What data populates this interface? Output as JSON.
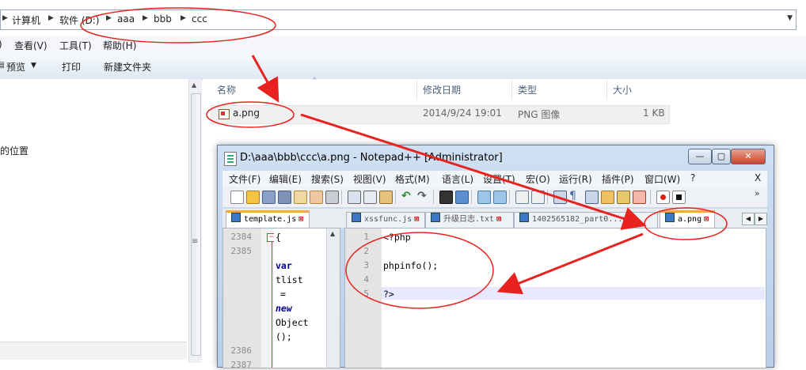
{
  "explorer": {
    "breadcrumbs": [
      "计算机",
      "软件 (D:)",
      "aaa",
      "bbb",
      "ccc"
    ],
    "menu": [
      "查看(V)",
      "工具(T)",
      "帮助(H)"
    ],
    "toolbar": [
      "预览",
      "打印",
      "新建文件夹"
    ],
    "nav_text": "的位置",
    "columns": [
      "名称",
      "修改日期",
      "类型",
      "大小"
    ],
    "file": {
      "name": "a.png",
      "date": "2014/9/24 19:01",
      "type": "PNG 图像",
      "size": "1 KB"
    }
  },
  "npp": {
    "title": "D:\\aaa\\bbb\\ccc\\a.png - Notepad++ [Administrator]",
    "buttons": {
      "min": "—",
      "max": "▢",
      "close": "✕"
    },
    "menu": [
      "文件(F)",
      "编辑(E)",
      "搜索(S)",
      "视图(V)",
      "格式(M)",
      "语言(L)",
      "设置(T)",
      "宏(O)",
      "运行(R)",
      "插件(P)",
      "窗口(W)",
      "?",
      "X"
    ],
    "tabs_left": [
      "template.js"
    ],
    "tabs_right": [
      "xssfunc.js",
      "升级日志.txt",
      "1402565182_part0...php",
      "a.png"
    ],
    "left_lines": [
      "2384",
      "2385",
      "2386",
      "2387"
    ],
    "left_code": [
      "{",
      "var",
      "tlist",
      "=",
      "new",
      "Object",
      "();"
    ],
    "right_lines": [
      "1",
      "2",
      "3",
      "4",
      "5"
    ],
    "right_code": [
      "<?php",
      "",
      "phpinfo();",
      "",
      "?>"
    ]
  },
  "colors": {
    "annotation": "#e8231f",
    "tab_accent": "#f5a64b",
    "selection": "#f0f0f0"
  }
}
